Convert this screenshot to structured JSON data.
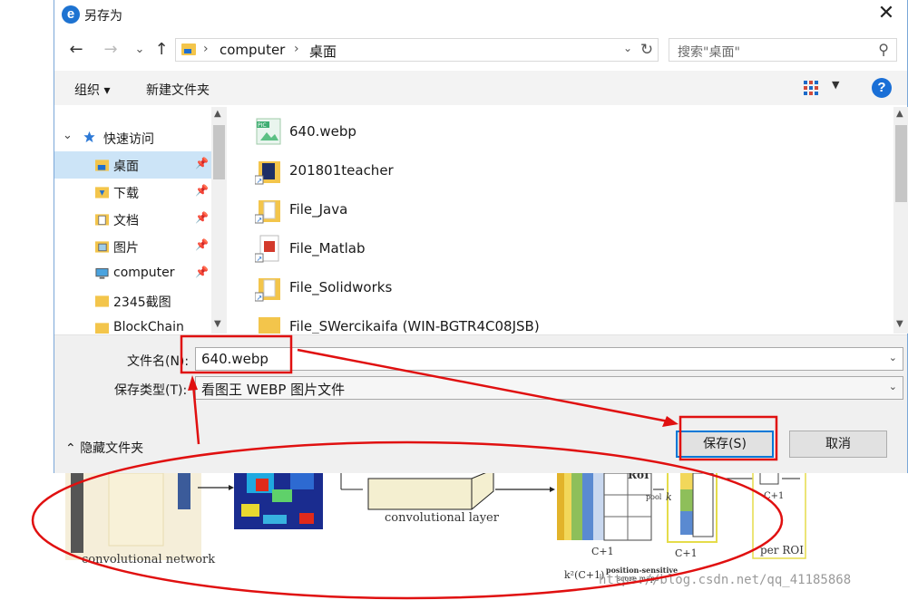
{
  "dialog": {
    "title": "另存为",
    "app_icon": "e",
    "close_glyph": "✕",
    "nav": {
      "back": "←",
      "forward": "→",
      "recent": "⌄",
      "up": "↑",
      "breadcrumb": [
        "computer",
        "桌面"
      ],
      "refresh": "↻",
      "search_placeholder": "搜索\"桌面\"",
      "search_icon": "⚲"
    },
    "toolbar": {
      "organize": "组织 ▾",
      "new_folder": "新建文件夹",
      "view_icon": "view-icon",
      "help": "?"
    },
    "sidebar": {
      "items": [
        {
          "label": "快速访问",
          "icon": "star-icon",
          "pinned": false,
          "header": true
        },
        {
          "label": "桌面",
          "icon": "desktop-folder-icon",
          "pinned": true,
          "selected": true
        },
        {
          "label": "下载",
          "icon": "download-folder-icon",
          "pinned": true
        },
        {
          "label": "文档",
          "icon": "document-folder-icon",
          "pinned": true
        },
        {
          "label": "图片",
          "icon": "picture-folder-icon",
          "pinned": true
        },
        {
          "label": "computer",
          "icon": "computer-icon",
          "pinned": true
        },
        {
          "label": "2345截图",
          "icon": "folder-icon",
          "pinned": false
        },
        {
          "label": "BlockChain",
          "icon": "folder-icon",
          "pinned": false
        }
      ]
    },
    "files": [
      {
        "name": "640.webp",
        "icon": "webp-image-icon"
      },
      {
        "name": "201801teacher",
        "icon": "shortcut-folder-icon"
      },
      {
        "name": "File_Java",
        "icon": "shortcut-folder-icon"
      },
      {
        "name": "File_Matlab",
        "icon": "shortcut-pdf-icon"
      },
      {
        "name": "File_Solidworks",
        "icon": "shortcut-folder-icon"
      },
      {
        "name": "File_SWercikaifa (WIN-BGTR4C08JSB)",
        "icon": "network-folder-icon"
      }
    ],
    "form": {
      "filename_label": "文件名(N):",
      "filename_value": "640.webp",
      "type_label": "保存类型(T):",
      "type_value": "看图王 WEBP 图片文件",
      "hide_folders": "隐藏文件夹",
      "save": "保存(S)",
      "cancel": "取消"
    }
  },
  "background": {
    "labels": {
      "conv_network": "convolutional network",
      "conv_layer": "convolutional layer",
      "roi": "RoI",
      "pool": "pool",
      "k": "k",
      "c_plus_1_a": "C+1",
      "c_plus_1_b": "C+1",
      "c_plus_1_c": "C+1",
      "k2": "k²(C+1)",
      "pos_sensitive": "position-sensitive",
      "score_maps": "score maps",
      "per_roi": "per ROI",
      "watermark": "https://blog.csdn.net/qq_41185868"
    }
  },
  "colors": {
    "accent": "#0078d7",
    "selection": "#cce4f7",
    "annotation_red": "#e01010"
  }
}
